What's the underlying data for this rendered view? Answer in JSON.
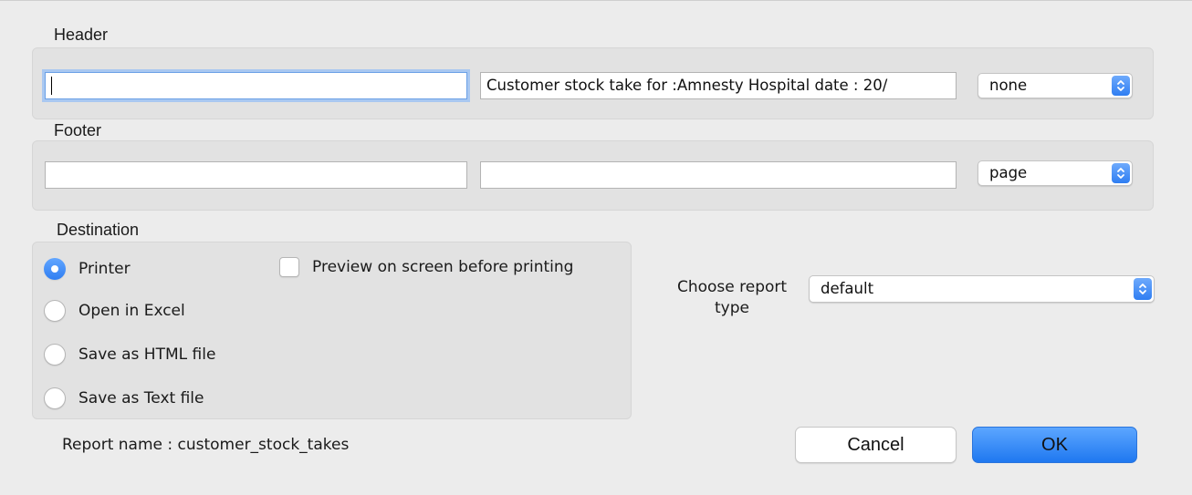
{
  "header": {
    "label": "Header",
    "left_value": "",
    "center_value": "Customer stock take for :Amnesty Hospital date : 20/",
    "popup_value": "none"
  },
  "footer": {
    "label": "Footer",
    "left_value": "",
    "center_value": "",
    "popup_value": "page"
  },
  "destination": {
    "label": "Destination",
    "options": [
      {
        "label": "Printer",
        "selected": true
      },
      {
        "label": "Open in Excel",
        "selected": false
      },
      {
        "label": "Save as HTML file",
        "selected": false
      },
      {
        "label": "Save as Text file",
        "selected": false
      }
    ],
    "preview_label": "Preview on screen before printing",
    "preview_checked": false
  },
  "report_type": {
    "label_line1": "Choose report",
    "label_line2": "type",
    "value": "default"
  },
  "report_name": "Report name :  customer_stock_takes",
  "buttons": {
    "cancel": "Cancel",
    "ok": "OK"
  },
  "colors": {
    "accent": "#2f7ef2",
    "focus_ring": "#a9c8f1",
    "window_bg": "#ececec",
    "group_bg": "#e2e2e2"
  }
}
